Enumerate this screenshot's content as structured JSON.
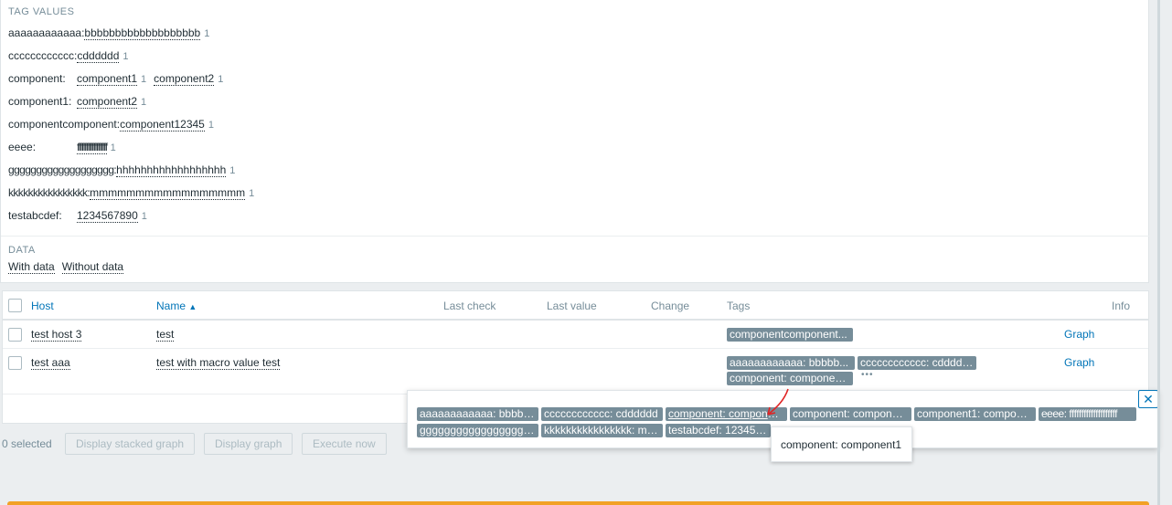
{
  "filter": {
    "tag_values_title": "TAG VALUES",
    "tag_rows": [
      {
        "key": "aaaaaaaaaaaa:",
        "values": [
          {
            "v": "bbbbbbbbbbbbbbbbbbb",
            "c": "1"
          }
        ]
      },
      {
        "key": "cccccccccccc:",
        "values": [
          {
            "v": "cdddddd",
            "c": "1"
          }
        ]
      },
      {
        "key": "component:",
        "values": [
          {
            "v": "component1",
            "c": "1"
          },
          {
            "v": "component2",
            "c": "1"
          }
        ]
      },
      {
        "key": "component1:",
        "values": [
          {
            "v": "component2",
            "c": "1"
          }
        ]
      },
      {
        "key": "componentcomponent:",
        "values": [
          {
            "v": "component12345",
            "c": "1"
          }
        ]
      },
      {
        "key": "eeee:",
        "values": [
          {
            "v": "ffffffffffffffffffff",
            "c": "1"
          }
        ]
      },
      {
        "key": "ggggggggggggggggggg:",
        "values": [
          {
            "v": "hhhhhhhhhhhhhhhhhh",
            "c": "1"
          }
        ]
      },
      {
        "key": "kkkkkkkkkkkkkkkk:",
        "values": [
          {
            "v": "mmmmmmmmmmmmmmmmm",
            "c": "1"
          }
        ]
      },
      {
        "key": "testabcdef:",
        "values": [
          {
            "v": "1234567890",
            "c": "1"
          }
        ]
      }
    ],
    "data_title": "DATA",
    "data_with": "With data",
    "data_without": "Without data"
  },
  "table": {
    "headers": {
      "host": "Host",
      "name": "Name",
      "name_sort": "▲",
      "last_check": "Last check",
      "last_value": "Last value",
      "change": "Change",
      "tags": "Tags",
      "info": "Info"
    },
    "rows": [
      {
        "host": "test host 3",
        "name": "test",
        "tags": [
          "componentcomponent..."
        ],
        "link": "Graph"
      },
      {
        "host": "test aaa",
        "name": "test with macro value test",
        "tags": [
          "aaaaaaaaaaaa: bbbbb...",
          "cccccccccccc: cdddddd",
          "component: component1"
        ],
        "more": "•••",
        "link": "Graph"
      }
    ]
  },
  "footer": {
    "selected": "0 selected",
    "stacked": "Display stacked graph",
    "graph": "Display graph",
    "execute": "Execute now"
  },
  "popup": {
    "close": "✕",
    "tags": [
      "aaaaaaaaaaaa: bbbbbbbbbbbbbbbbbbb",
      "cccccccccccc: cdddddd",
      "component: component1",
      "component: component2",
      "component1: component2",
      "eeee: ffffffffffffffffffff",
      "ggggggggggggggggggg: hhhhhhhhhhhhhhhhhh",
      "kkkkkkkkkkkkkkkk: mmmmmmmmmmmmmmmmm",
      "testabcdef: 1234567890"
    ],
    "tooltip": "component: component1"
  },
  "colors": {
    "tag_bg": "#768d99",
    "link": "#0275b8",
    "annotation": "#e02424",
    "warning_bar": "#f2a126"
  }
}
